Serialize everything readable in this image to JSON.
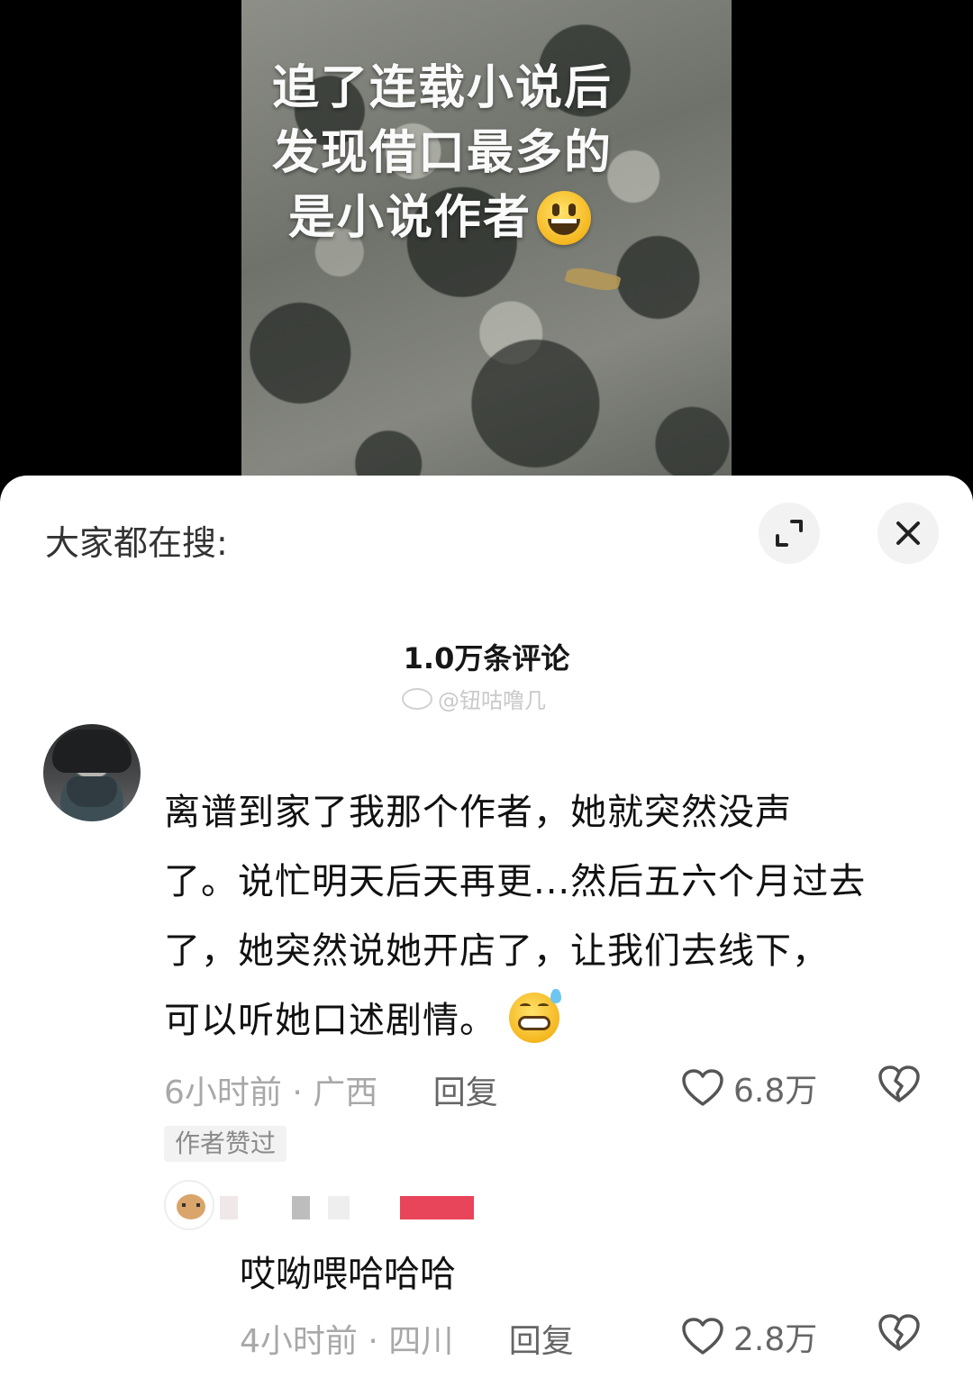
{
  "video": {
    "caption_lines": [
      "追了连载小说后",
      "发现借口最多的",
      "是小说作者"
    ]
  },
  "sheet": {
    "search_label": "大家都在搜:",
    "comment_count": "1.0万条评论",
    "watermark": "@钮咕噜几"
  },
  "comment": {
    "text_lines": [
      "离谱到家了我那个作者，她就突然没声",
      "了。说忙明天后天再更...然后五六个月过去",
      "了，她突然说她开店了，让我们去线下，",
      "可以听她口述剧情。"
    ],
    "time_location": "6小时前 · 广西",
    "reply_label": "回复",
    "likes": "6.8万",
    "author_badge": "作者赞过"
  },
  "reply": {
    "text": "哎呦喂哈哈哈",
    "time_location": "4小时前 · 四川",
    "reply_label": "回复",
    "likes": "2.8万"
  },
  "icons": {
    "expand": "expand-icon",
    "close": "close-icon",
    "heart": "heart-icon",
    "dislike": "broken-heart-icon"
  },
  "colors": {
    "sheet_bg": "#ffffff",
    "meta_gray": "#a8a8a8",
    "redaction_red": "#e8445a"
  }
}
